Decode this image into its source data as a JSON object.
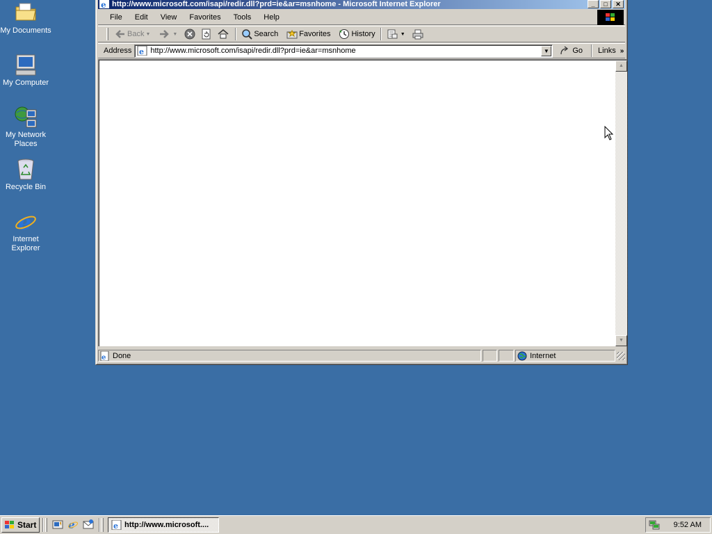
{
  "desktop": {
    "icons": [
      {
        "label": "My Documents",
        "icon": "folder-icon"
      },
      {
        "label": "My Computer",
        "icon": "computer-icon"
      },
      {
        "label": "My Network Places",
        "icon": "network-icon"
      },
      {
        "label": "Recycle Bin",
        "icon": "recycle-bin-icon"
      },
      {
        "label": "Internet Explorer",
        "icon": "ie-icon"
      }
    ],
    "background": "#3a6ea5"
  },
  "window": {
    "title": "http://www.microsoft.com/isapi/redir.dll?prd=ie&ar=msnhome - Microsoft Internet Explorer",
    "title_buttons": [
      "_",
      "□",
      "✕"
    ],
    "menu": [
      "File",
      "Edit",
      "View",
      "Favorites",
      "Tools",
      "Help"
    ],
    "toolbar": {
      "back": "Back",
      "search": "Search",
      "favorites": "Favorites",
      "history": "History"
    },
    "address": {
      "label": "Address",
      "url": "http://www.microsoft.com/isapi/redir.dll?prd=ie&ar=msnhome",
      "go": "Go",
      "links": "Links"
    },
    "status": {
      "text": "Done",
      "zone": "Internet"
    }
  },
  "taskbar": {
    "start": "Start",
    "task_title": "http://www.microsoft....",
    "clock": "9:52 AM"
  },
  "colors": {
    "title_gradient_start": "#0a246a",
    "title_gradient_end": "#a6caf0",
    "chrome": "#d4d0c8"
  }
}
